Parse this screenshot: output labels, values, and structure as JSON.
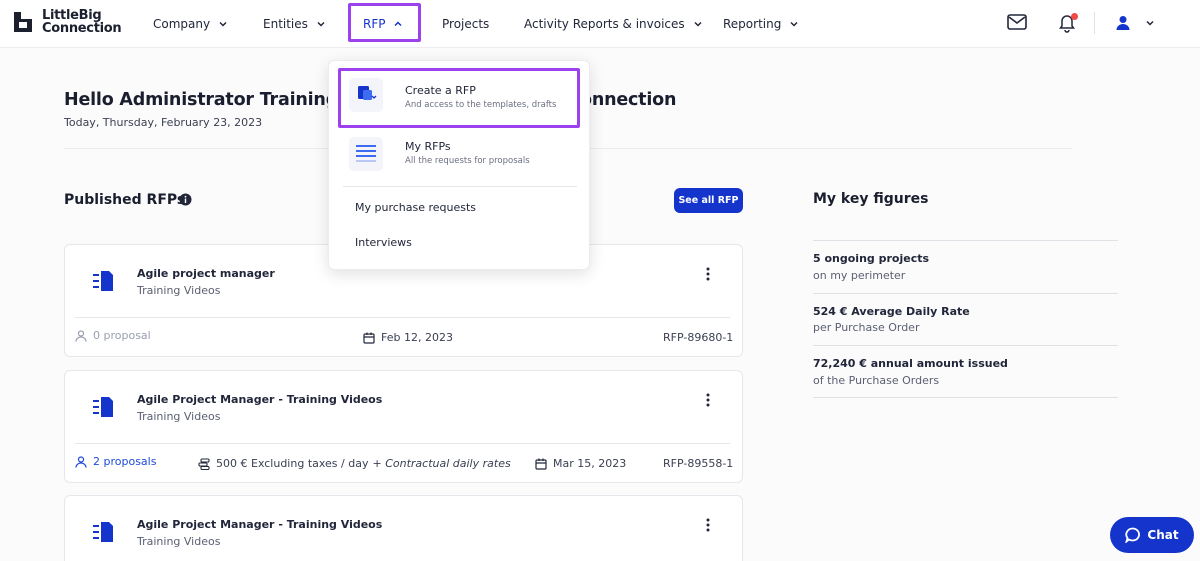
{
  "brand": {
    "line1": "LittleBig",
    "line2": "Connection"
  },
  "nav": {
    "company": "Company",
    "entities": "Entities",
    "rfp": "RFP",
    "projects": "Projects",
    "activity": "Activity Reports & invoices",
    "reporting": "Reporting"
  },
  "header_icons": {
    "mail": "mail-icon",
    "bell": "bell-icon",
    "user": "user-icon"
  },
  "greeting": {
    "start": "Hello Administrator Training V",
    "end": "onnection",
    "date": "Today, Thursday, February 23, 2023"
  },
  "dropdown": {
    "create_label": "Create a RFP",
    "create_sub": "And access to the templates, drafts",
    "my_label": "My RFPs",
    "my_sub": "All the requests for proposals",
    "purchase": "My purchase requests",
    "interviews": "Interviews"
  },
  "published": {
    "title": "Published RFPs",
    "see_all": "See all RFP"
  },
  "cards": [
    {
      "title": "Agile project manager",
      "sub": "Training Videos",
      "proposals": "0 proposal",
      "date": "Feb 12, 2023",
      "ref": "RFP-89680-1"
    },
    {
      "title": "Agile Project Manager - Training Videos",
      "sub": "Training Videos",
      "proposals": "2 proposals",
      "rate": "500 € Excluding taxes / day",
      "rate_note": "+ Contractual daily rates",
      "date": "Mar 15, 2023",
      "ref": "RFP-89558-1"
    },
    {
      "title": "Agile Project Manager - Training Videos",
      "sub": "Training Videos"
    }
  ],
  "key_figures": {
    "title": "My key figures",
    "items": [
      {
        "main": "5 ongoing projects",
        "sub": "on my perimeter"
      },
      {
        "main": "524 € Average Daily Rate",
        "sub": "per Purchase Order"
      },
      {
        "main": "72,240 € annual amount issued",
        "sub": "of the Purchase Orders"
      }
    ]
  },
  "chat": {
    "label": "Chat"
  },
  "colors": {
    "primary": "#1434cb",
    "highlight": "#9b42ee",
    "badge": "#f04a4a"
  }
}
